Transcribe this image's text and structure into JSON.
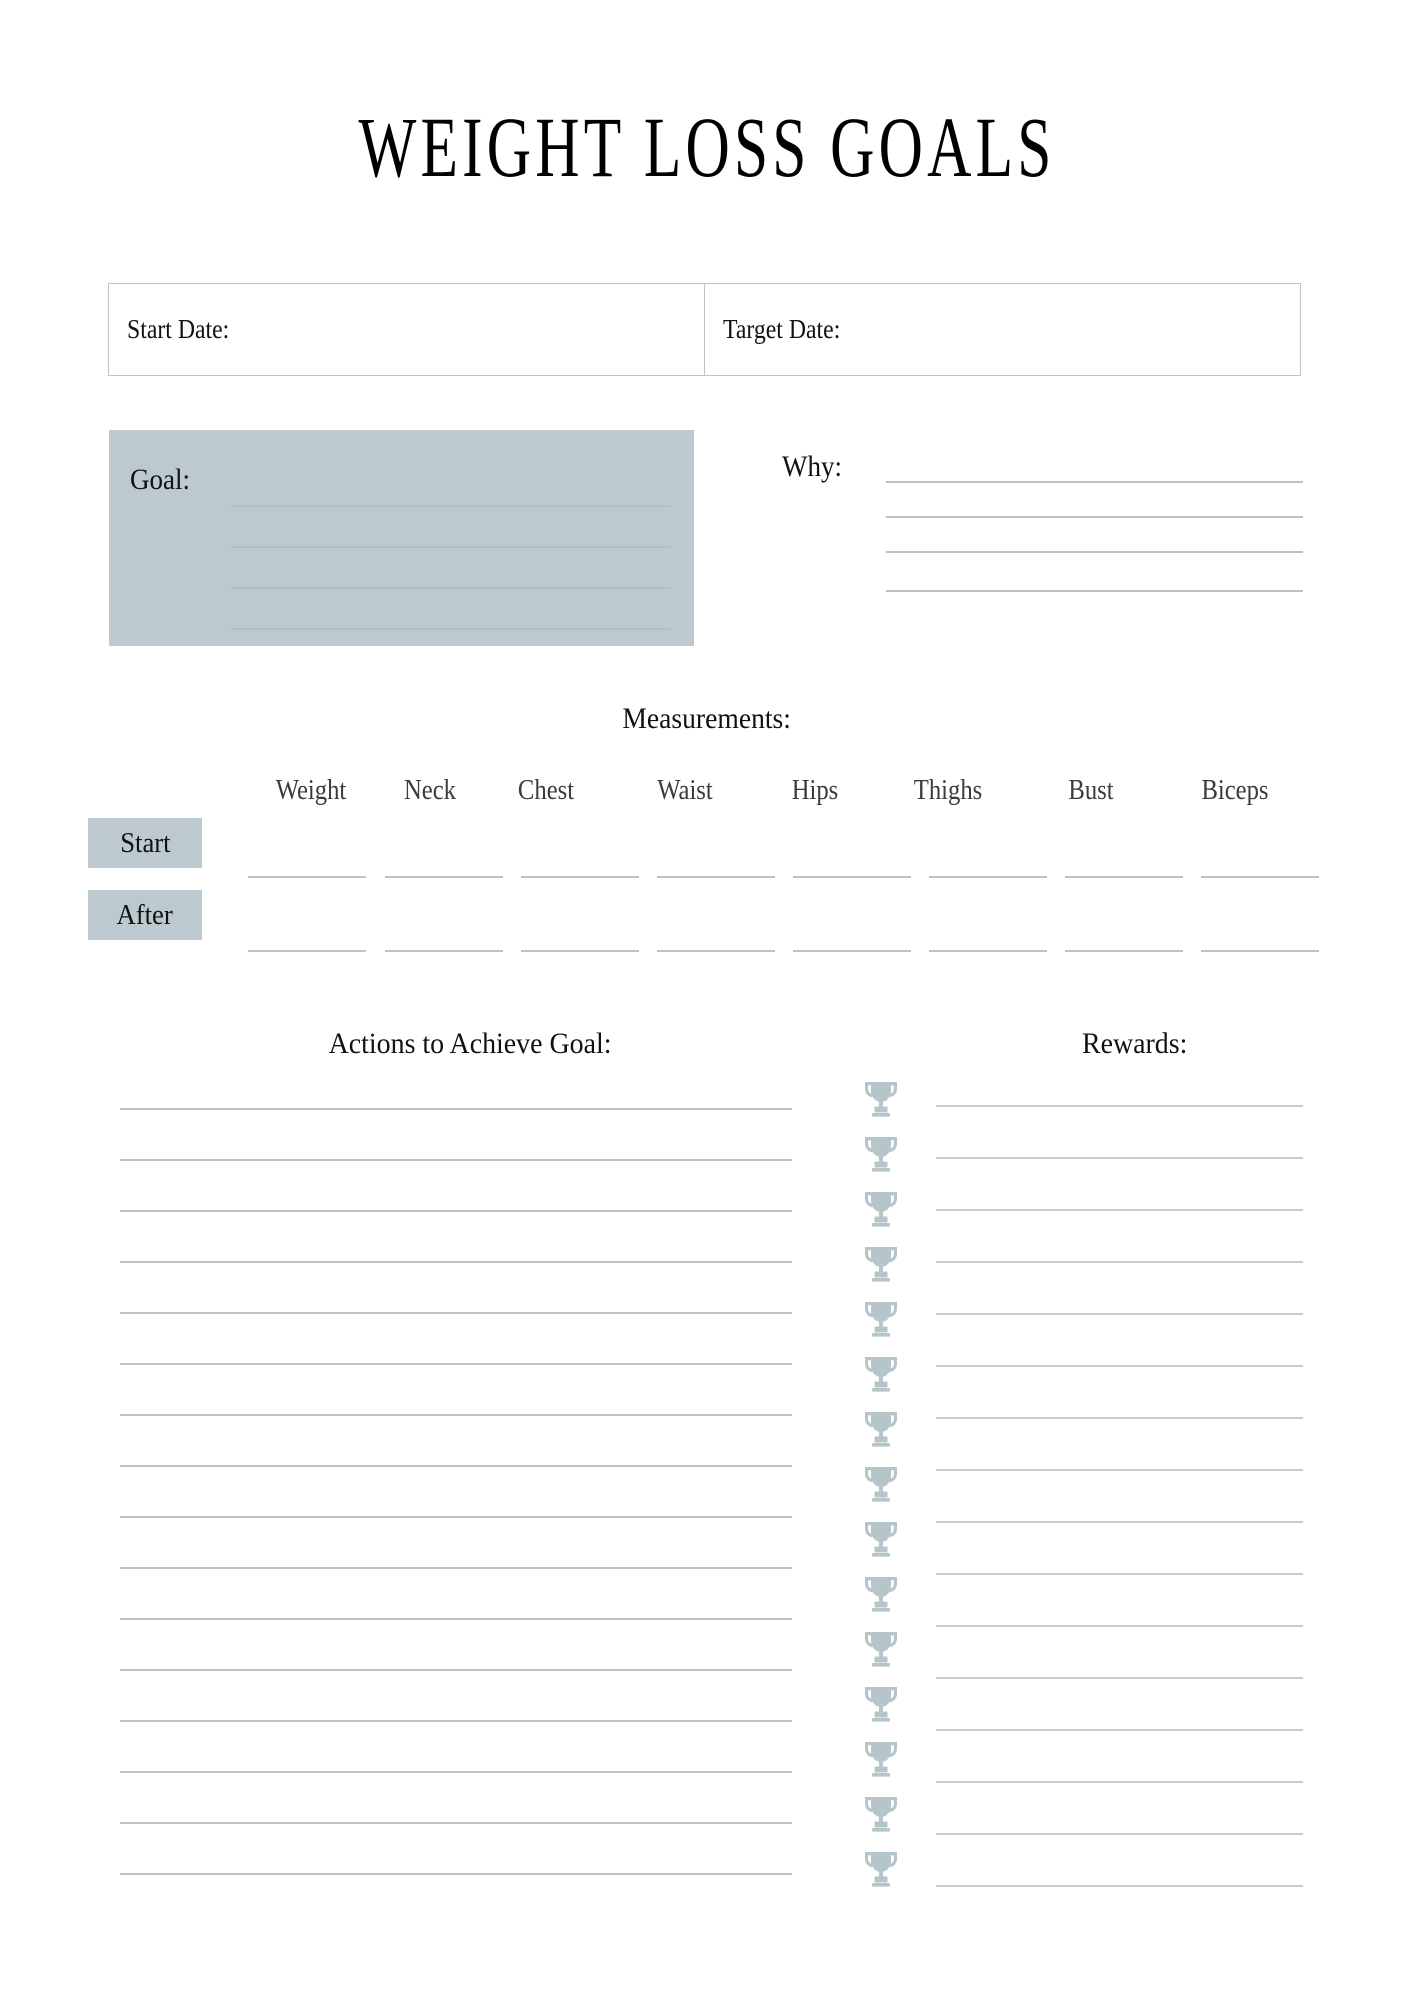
{
  "document": {
    "title": "WEIGHT LOSS GOALS"
  },
  "dates": {
    "start_label": "Start Date:",
    "start_value": "",
    "target_label": "Target Date:",
    "target_value": ""
  },
  "goal": {
    "label": "Goal:",
    "value": "",
    "line_count": 4,
    "fill_color": "#bcc9ce"
  },
  "why": {
    "label": "Why:",
    "value": "",
    "line_count": 4
  },
  "measurements": {
    "title": "Measurements:",
    "columns": [
      "Weight",
      "Neck",
      "Chest",
      "Waist",
      "Hips",
      "Thighs",
      "Bust",
      "Biceps"
    ],
    "rows": [
      {
        "label": "Start",
        "values": [
          "",
          "",
          "",
          "",
          "",
          "",
          "",
          ""
        ]
      },
      {
        "label": "After",
        "values": [
          "",
          "",
          "",
          "",
          "",
          "",
          "",
          ""
        ]
      }
    ]
  },
  "actions": {
    "heading": "Actions to Achieve Goal:",
    "line_count": 16,
    "entries": []
  },
  "rewards": {
    "heading": "Rewards:",
    "line_count": 16,
    "entries": []
  },
  "decorations": {
    "trophy_icon": "trophy-icon",
    "trophy_count": 15
  },
  "colors": {
    "accent": "#bcc9ce",
    "rule": "#b8c6cb",
    "border": "#b9c7cc",
    "text": "#111111",
    "muted_text": "#3b3b3b",
    "background": "#ffffff"
  }
}
